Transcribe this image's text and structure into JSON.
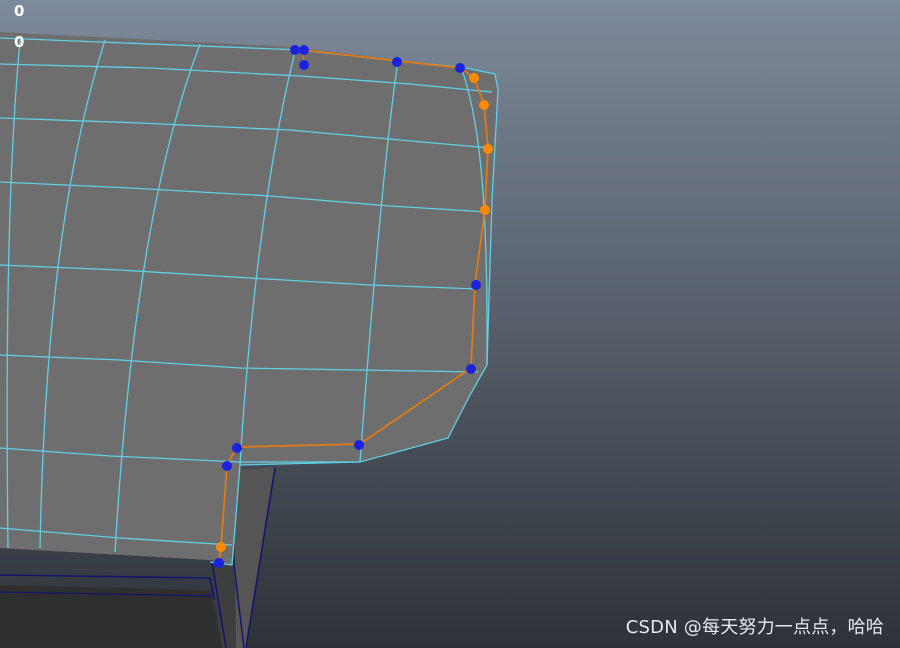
{
  "viewport": {
    "background_top": "#7d8a9b",
    "background_bottom": "#2e3238",
    "mesh_fill": "#6e6e6e",
    "wireframe_color": "#5fd0e8",
    "dark_edge_color": "#14146e",
    "path_color": "#e07a18",
    "vertex_selected_color": "#ff8a00",
    "vertex_unselected_color": "#1a22e0"
  },
  "hud": {
    "readout_1": "0",
    "readout_2": "0"
  },
  "watermark": {
    "text": "CSDN @每天努力一点点，哈哈"
  }
}
